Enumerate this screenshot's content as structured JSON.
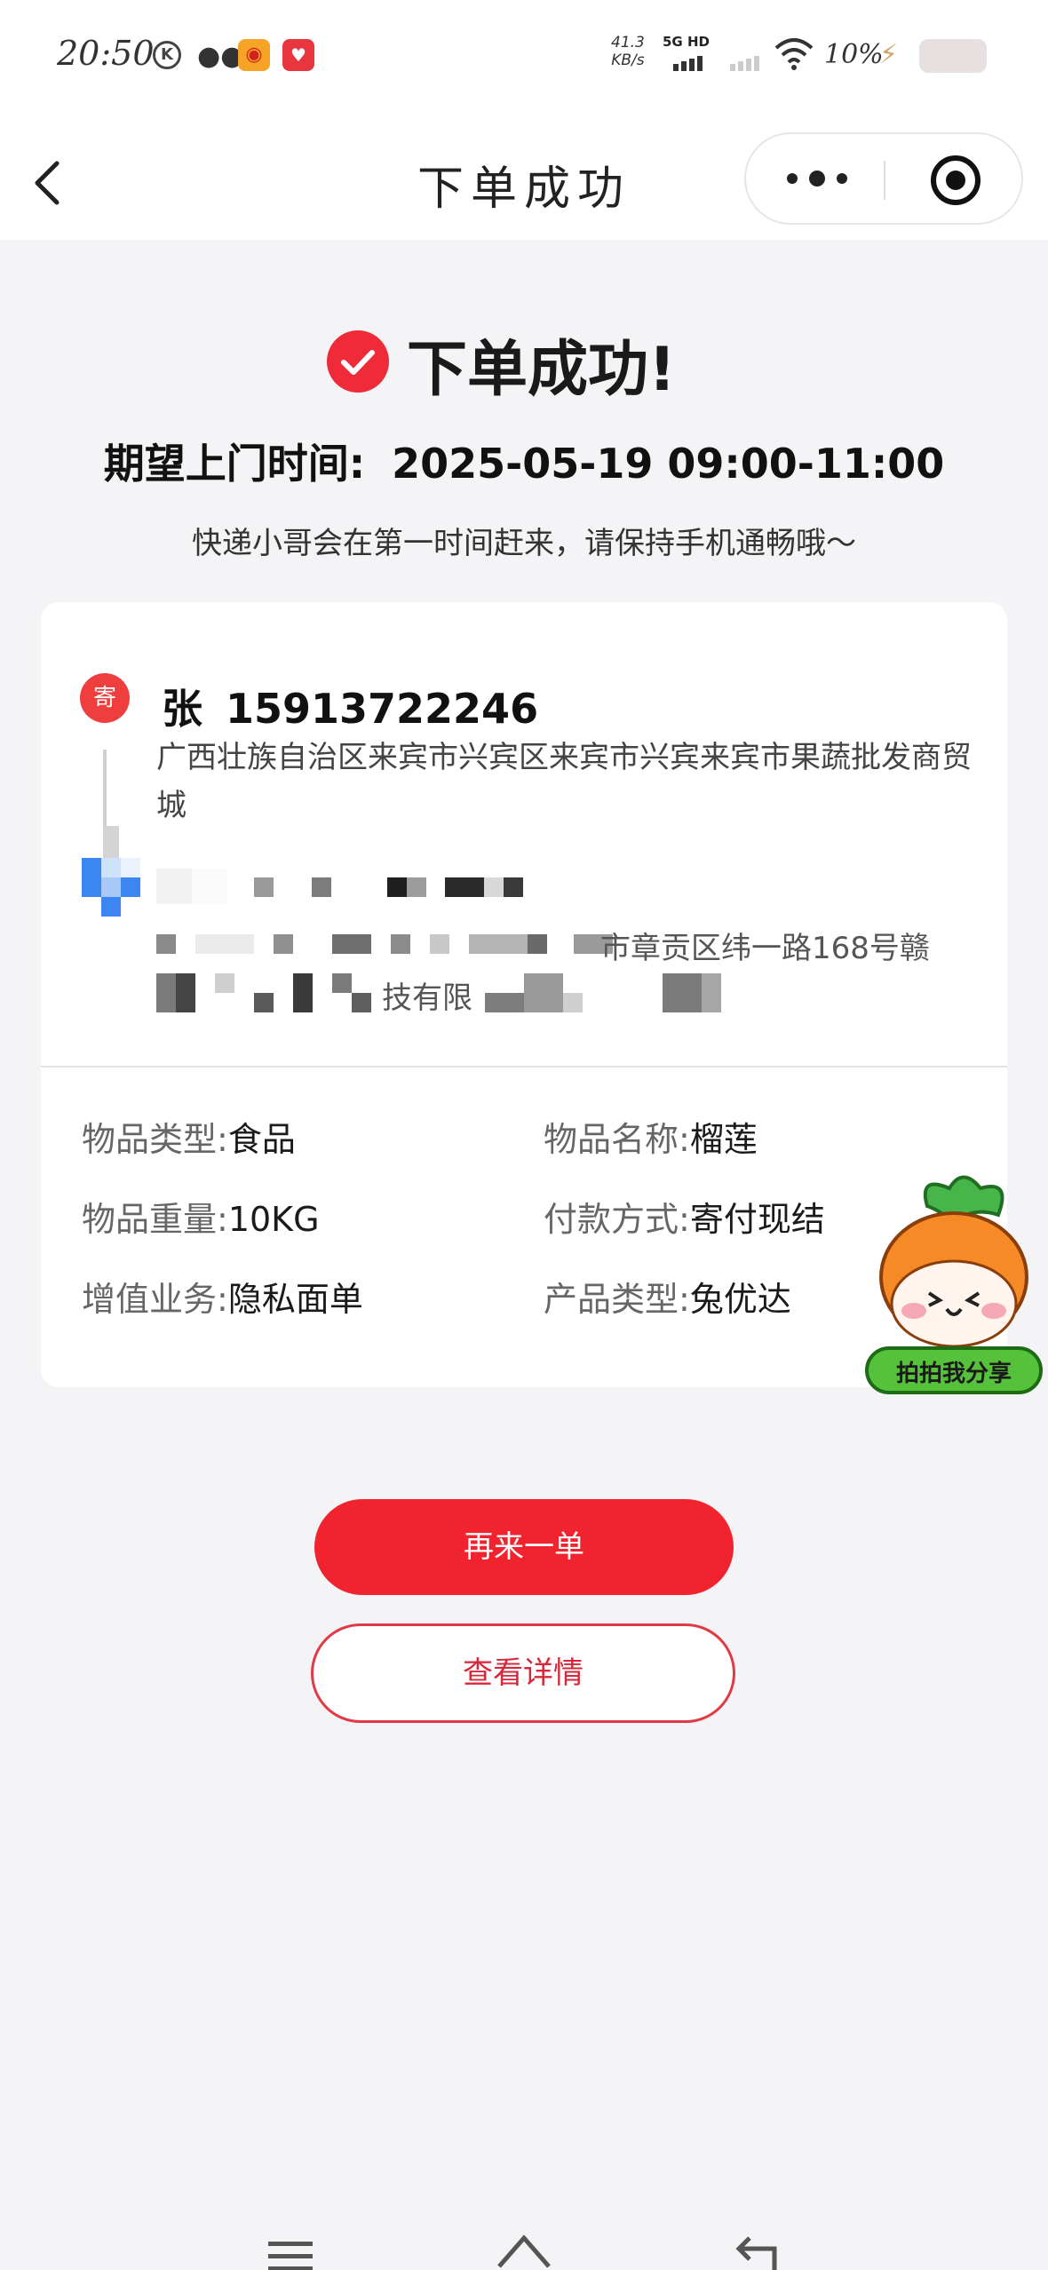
{
  "status_bar": {
    "time": "20:50",
    "net_speed_value": "41.3",
    "net_speed_unit": "KB/s",
    "network": "5G HD",
    "battery": "10%"
  },
  "nav": {
    "title": "下单成功"
  },
  "success": {
    "title": "下单成功!",
    "expect_label": "期望上门时间:",
    "expect_value": "2025-05-19 09:00-11:00",
    "hint": "快递小哥会在第一时间赶来，请保持手机通畅哦～"
  },
  "sender": {
    "badge": "寄",
    "name": "张",
    "phone": "15913722246",
    "address": "广西壮族自治区来宾市兴宾区来宾市兴宾来宾市果蔬批发商贸城"
  },
  "receiver": {
    "address_visible_1": "市章贡区纬一路168号赣",
    "address_visible_2": "技有限"
  },
  "details": [
    {
      "label": "物品类型:",
      "value": "食品"
    },
    {
      "label": "物品名称:",
      "value": "榴莲"
    },
    {
      "label": "物品重量:",
      "value": "10KG"
    },
    {
      "label": "付款方式:",
      "value": "寄付现结"
    },
    {
      "label": "增值业务:",
      "value": "隐私面单"
    },
    {
      "label": "产品类型:",
      "value": "兔优达"
    }
  ],
  "mascot": {
    "label": "拍拍我分享"
  },
  "buttons": {
    "reorder": "再来一单",
    "view_details": "查看详情"
  },
  "colors": {
    "accent": "#f0232e",
    "background": "#f4f4f6",
    "card": "#ffffff"
  }
}
